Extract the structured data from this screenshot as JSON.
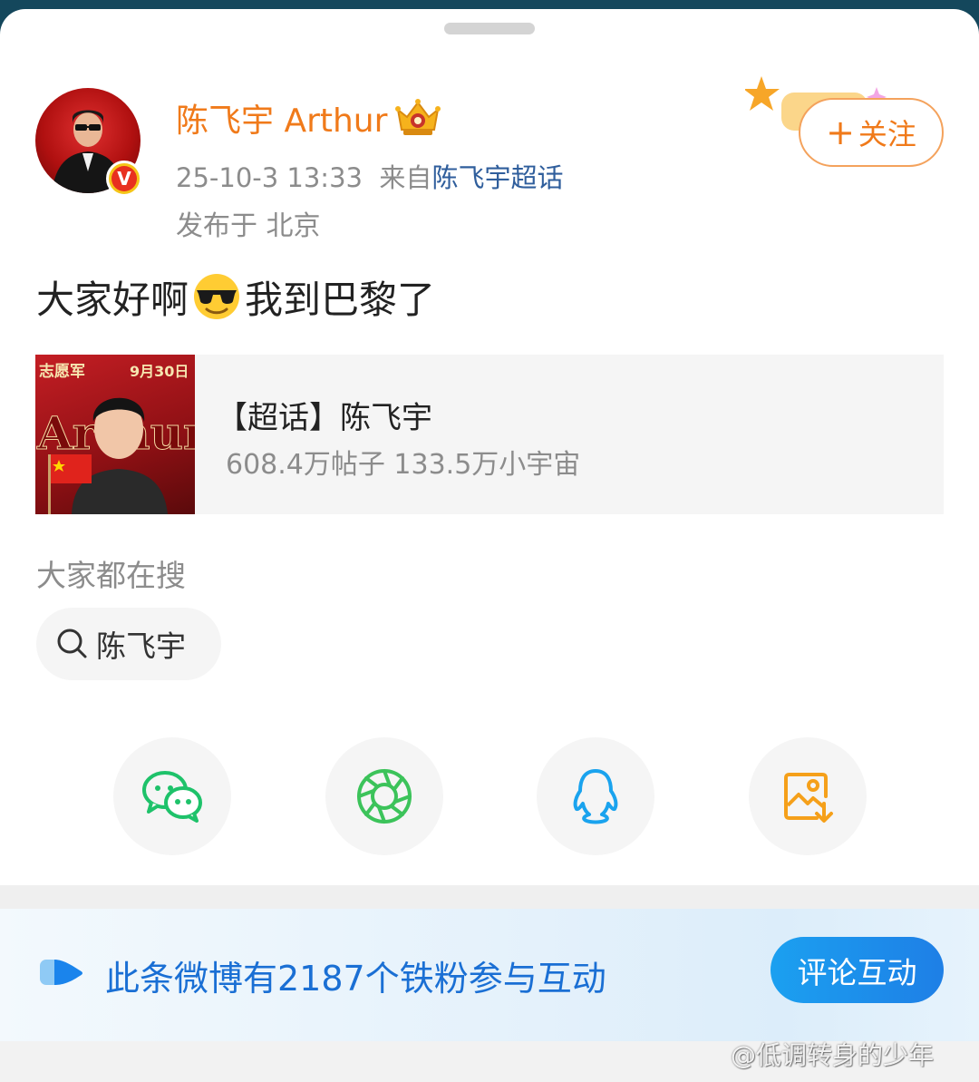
{
  "post": {
    "author_name": "陈飞宇 Arthur",
    "timestamp": "25-10-3 13:33",
    "source_prefix": "来自",
    "source_name": "陈飞宇超话",
    "location": "发布于 北京",
    "text_before_emoji": "大家好啊",
    "emoji": "cool-sunglasses-emoji",
    "text_after_emoji": "我到巴黎了",
    "follow_label": "关注"
  },
  "supertopic_card": {
    "title": "【超话】陈飞宇",
    "stats": "608.4万帖子 133.5万小宇宙",
    "thumbnail_texts": [
      "志愿军",
      "9月30日",
      "Arthur"
    ]
  },
  "search": {
    "section_label": "大家都在搜",
    "chip_label": "陈飞宇"
  },
  "share_targets": [
    {
      "icon": "wechat-icon",
      "color": "#1ec26a"
    },
    {
      "icon": "moments-icon",
      "color": "#3cc35a"
    },
    {
      "icon": "qq-icon",
      "color": "#1aa3ee"
    },
    {
      "icon": "save-image-icon",
      "color": "#f5a01a"
    }
  ],
  "banner": {
    "text": "此条微博有2187个铁粉参与互动",
    "button_label": "评论互动"
  },
  "watermark": "@低调转身的少年",
  "colors": {
    "accent_orange": "#f07a1a",
    "link_blue": "#2f5e9c",
    "banner_blue": "#1a6fd4"
  }
}
